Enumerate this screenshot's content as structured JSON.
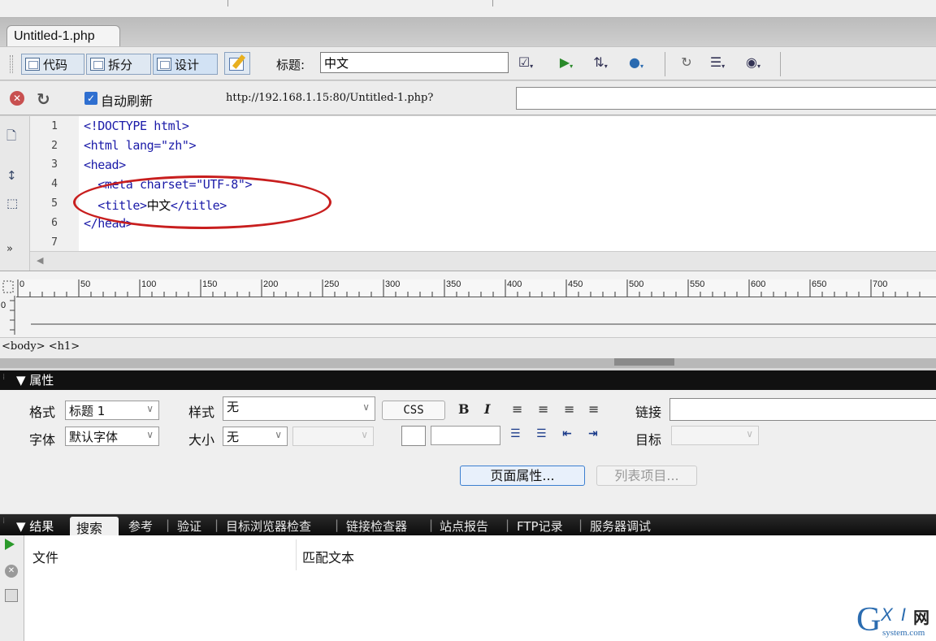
{
  "document": {
    "tab_title": "Untitled-1.php"
  },
  "doc_toolbar": {
    "code_label": "代码",
    "split_label": "拆分",
    "design_label": "设计",
    "title_label": "标题:",
    "title_value": "中文"
  },
  "browser_bar": {
    "auto_refresh_label": "自动刷新",
    "auto_refresh_checked": true,
    "url": "http://192.168.1.15:80/Untitled-1.php?"
  },
  "code": {
    "line_numbers": [
      "1",
      "2",
      "3",
      "4",
      "5",
      "6",
      "7"
    ],
    "lines": [
      "<!DOCTYPE html>",
      "<html lang=\"zh\">",
      "<head>",
      "  <meta charset=\"UTF-8\">",
      "  <title>",
      "</head>",
      ""
    ],
    "line5_text": "中文",
    "line5_close": "</title>",
    "annotation_color": "#c81e1e"
  },
  "ruler": {
    "labels": [
      "0",
      "50",
      "100",
      "150",
      "200",
      "250",
      "300",
      "350",
      "400",
      "450",
      "500",
      "550",
      "600",
      "650",
      "700"
    ],
    "vertical_label": "0"
  },
  "tag_selector": {
    "path": "<body> <h1>"
  },
  "properties": {
    "header": "▼ 属性",
    "format_label": "格式",
    "format_value": "标题 1",
    "style_label": "样式",
    "style_value": "无",
    "css_button": "CSS",
    "link_label": "链接",
    "font_label": "字体",
    "font_value": "默认字体",
    "size_label": "大小",
    "size_value": "无",
    "target_label": "目标",
    "page_properties_button": "页面属性...",
    "list_item_button": "列表项目..."
  },
  "results": {
    "header": "▼ 结果",
    "tabs": [
      "搜索",
      "参考",
      "验证",
      "目标浏览器检查",
      "链接检查器",
      "站点报告",
      "FTP记录",
      "服务器调试"
    ],
    "active_tab": "搜索",
    "col_file": "文件",
    "col_match": "匹配文本"
  },
  "watermark": {
    "g": "G",
    "xi": "X I",
    "net": "网",
    "domain": "system.com"
  },
  "colors": {
    "accent": "#3c7fd0",
    "panel_header": "#111111"
  }
}
